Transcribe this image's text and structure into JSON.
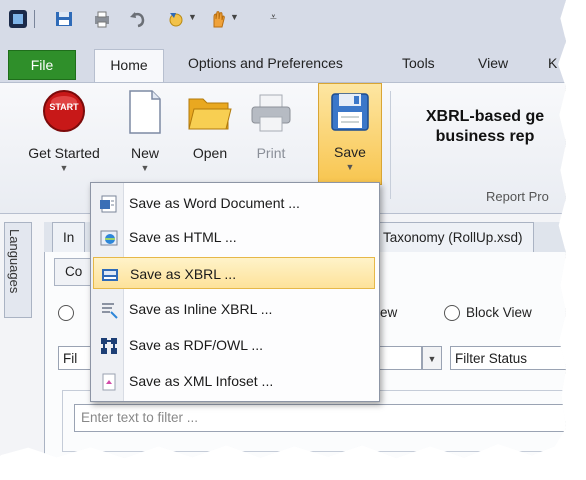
{
  "quick_access": {
    "icons": [
      "app-icon",
      "save-icon",
      "print-icon",
      "undo-icon",
      "refresh-icon",
      "hand-icon",
      "customize-icon"
    ]
  },
  "tabs": [
    {
      "label": "File"
    },
    {
      "label": "Home"
    },
    {
      "label": "Options and Preferences"
    },
    {
      "label": "Tools"
    },
    {
      "label": "View"
    },
    {
      "label": "K"
    }
  ],
  "ribbon": {
    "get_started": "Get Started",
    "get_started_badge": "START",
    "new": "New",
    "open": "Open",
    "print": "Print",
    "save": "Save",
    "title_line1": "XBRL-based ge",
    "title_line2": "business rep",
    "group_label": "Report Pro"
  },
  "side_tab": {
    "label": "Languages"
  },
  "doc_tabs": [
    {
      "label": "In"
    },
    {
      "label": "Taxonomy (RollUp.xsd)"
    }
  ],
  "subtab": {
    "label": "Co"
  },
  "view_options": {
    "radio_partial": "ew",
    "block_view": "Block View"
  },
  "filters": {
    "left_combo": "Fil",
    "status_combo": "Filter Status",
    "text_placeholder": "Enter text to filter ..."
  },
  "save_menu": {
    "items": [
      {
        "label": "Save as Word Document ...",
        "icon": "word-doc-icon"
      },
      {
        "label": "Save as HTML ...",
        "icon": "html-icon"
      },
      {
        "label": "Save as XBRL ...",
        "icon": "xbrl-icon",
        "highlighted": true
      },
      {
        "label": "Save as Inline XBRL ...",
        "icon": "inline-xbrl-icon"
      },
      {
        "label": "Save as RDF/OWL ...",
        "icon": "rdf-owl-icon"
      },
      {
        "label": "Save as XML Infoset ...",
        "icon": "xml-infoset-icon"
      }
    ]
  }
}
